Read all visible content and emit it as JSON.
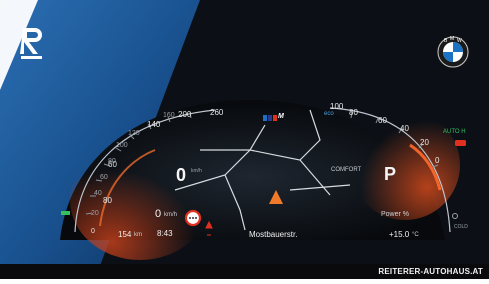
{
  "dealer": {
    "watermark": "REITERER-AUTOHAUS.AT"
  },
  "brand": {
    "letters": [
      "B",
      "M",
      "W"
    ],
    "mode_logo": "M"
  },
  "speedometer": {
    "ticks": [
      "0",
      "20",
      "40",
      "60",
      "80",
      "100",
      "120",
      "140",
      "160",
      "180",
      "200",
      "220",
      "240",
      "260"
    ],
    "speed_value": "0",
    "speed_unit": "km/h",
    "odometer_value": "0",
    "odometer_unit": "km/h"
  },
  "tachometer": {
    "ticks": [
      "0",
      "20",
      "40",
      "60",
      "80",
      "100"
    ],
    "eco_label": "eco",
    "gear": "P",
    "drive_mode": "COMFORT",
    "power_label": "Power %",
    "auto_h_label": "AUTO H"
  },
  "status_bar": {
    "range": "154",
    "range_unit": "km",
    "time": "8:43",
    "street": "Mostbauerstr.",
    "temperature": "+15.0",
    "temperature_unit": "°C",
    "cold_label": "COLD"
  },
  "colors": {
    "accent_red": "#e03020",
    "accent_green": "#35c060",
    "cluster_bg": "#0c1016",
    "page_blue": "#1f5fa6"
  }
}
